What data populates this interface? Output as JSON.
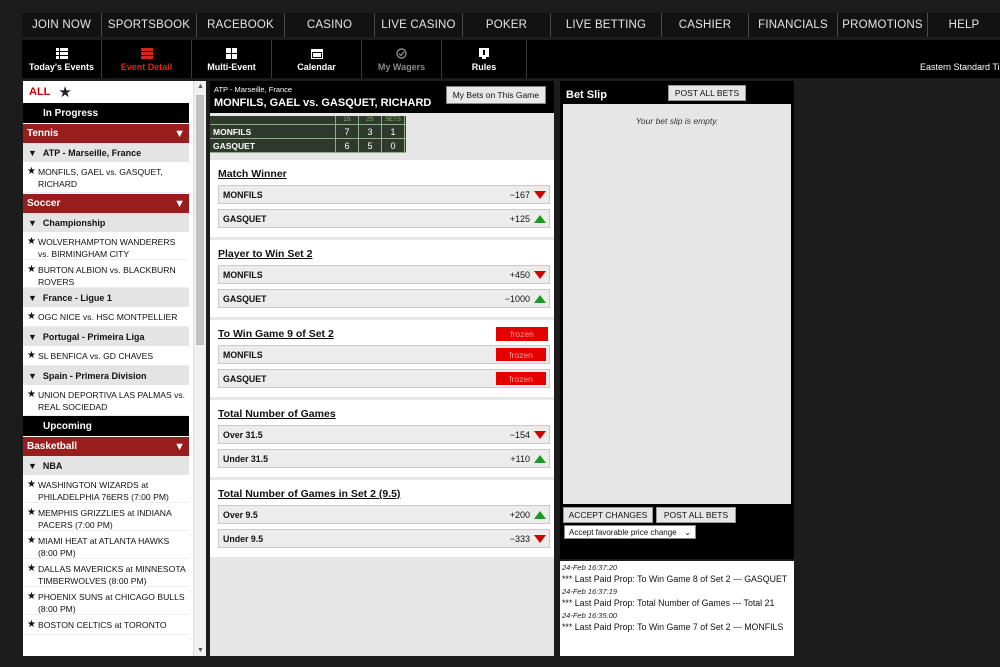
{
  "nav": [
    "JOIN NOW",
    "SPORTSBOOK",
    "RACEBOOK",
    "CASINO",
    "LIVE CASINO",
    "POKER",
    "LIVE BETTING",
    "CASHIER",
    "FINANCIALS",
    "PROMOTIONS",
    "HELP"
  ],
  "toolbar": {
    "items": [
      {
        "label": "Today's Events",
        "icon": "list-icon"
      },
      {
        "label": "Event Detail",
        "icon": "event-detail-icon"
      },
      {
        "label": "Multi-Event",
        "icon": "grid-icon"
      },
      {
        "label": "Calendar",
        "icon": "calendar-icon"
      },
      {
        "label": "My Wagers",
        "icon": "check-circle-icon"
      },
      {
        "label": "Rules",
        "icon": "book-icon"
      }
    ],
    "timezone": "Eastern Standard Time"
  },
  "sidebar": {
    "all_label": "ALL",
    "in_progress": "In Progress",
    "upcoming": "Upcoming",
    "tennis": {
      "sport": "Tennis",
      "league": "ATP - Marseille, France",
      "event": "MONFILS, GAEL vs. GASQUET, RICHARD"
    },
    "soccer": {
      "sport": "Soccer",
      "leagues": [
        {
          "name": "Championship",
          "events": [
            "WOLVERHAMPTON WANDERERS vs. BIRMINGHAM CITY",
            "BURTON ALBION vs. BLACKBURN ROVERS"
          ]
        },
        {
          "name": "France - Ligue 1",
          "events": [
            "OGC NICE vs. HSC MONTPELLIER"
          ]
        },
        {
          "name": "Portugal - Primeira Liga",
          "events": [
            "SL BENFICA vs. GD CHAVES"
          ]
        },
        {
          "name": "Spain - Primera Division",
          "events": [
            "UNION DEPORTIVA LAS PALMAS vs. REAL SOCIEDAD"
          ]
        }
      ]
    },
    "basketball": {
      "sport": "Basketball",
      "league": "NBA",
      "events": [
        "WASHINGTON WIZARDS at PHILADELPHIA 76ERS (7:00 PM)",
        "MEMPHIS GRIZZLIES at INDIANA PACERS (7:00 PM)",
        "MIAMI HEAT at ATLANTA HAWKS (8:00 PM)",
        "DALLAS MAVERICKS at MINNESOTA TIMBERWOLVES (8:00 PM)",
        "PHOENIX SUNS at CHICAGO BULLS (8:00 PM)",
        "BOSTON CELTICS at TORONTO"
      ]
    }
  },
  "event": {
    "league": "ATP - Marseille, France",
    "title": "MONFILS, GAEL vs. GASQUET, RICHARD",
    "my_bets_button": "My Bets on This Game",
    "scoreboard": {
      "headers": [
        "1S",
        "2S",
        "SETS"
      ],
      "rows": [
        {
          "name": "MONFILS",
          "scores": [
            "7",
            "3",
            "1"
          ]
        },
        {
          "name": "GASQUET",
          "scores": [
            "6",
            "5",
            "0"
          ]
        }
      ]
    }
  },
  "markets": [
    {
      "title": "Match Winner",
      "frozen": "",
      "selections": [
        {
          "name": "MONFILS",
          "odds": "−167",
          "trend": "down"
        },
        {
          "name": "GASQUET",
          "odds": "+125",
          "trend": "up"
        }
      ]
    },
    {
      "title": "Player to Win Set 2",
      "frozen": "",
      "selections": [
        {
          "name": "MONFILS",
          "odds": "+450",
          "trend": "down"
        },
        {
          "name": "GASQUET",
          "odds": "−1000",
          "trend": "up"
        }
      ]
    },
    {
      "title": "To Win Game 9 of Set 2",
      "frozen": "frozen",
      "selections": [
        {
          "name": "MONFILS",
          "odds": "frozen",
          "trend": "frozen"
        },
        {
          "name": "GASQUET",
          "odds": "frozen",
          "trend": "frozen"
        }
      ]
    },
    {
      "title": "Total Number of Games",
      "frozen": "",
      "selections": [
        {
          "name": "Over 31.5",
          "odds": "−154",
          "trend": "down"
        },
        {
          "name": "Under 31.5",
          "odds": "+110",
          "trend": "up"
        }
      ]
    },
    {
      "title": "Total Number of Games in Set 2 (9.5)",
      "frozen": "",
      "selections": [
        {
          "name": "Over 9.5",
          "odds": "+200",
          "trend": "up"
        },
        {
          "name": "Under 9.5",
          "odds": "−333",
          "trend": "down"
        }
      ]
    }
  ],
  "betslip": {
    "title": "Bet Slip",
    "post_all_top": "POST ALL BETS",
    "empty_message": "Your bet slip is empty.",
    "accept_changes": "ACCEPT CHANGES",
    "post_all_bottom": "POST ALL BETS",
    "price_option": "Accept favorable price change"
  },
  "last_paid": [
    {
      "time": "24-Feb 16:37:20",
      "text": "*** Last Paid Prop: To Win Game 8 of Set 2 --- GASQUET"
    },
    {
      "time": "24-Feb 16:37:19",
      "text": "*** Last Paid Prop: Total Number of Games --- Total 21"
    },
    {
      "time": "24-Feb 16:35:00",
      "text": "*** Last Paid Prop: To Win Game 7 of Set 2 --- MONFILS"
    }
  ],
  "colors": {
    "accent_red": "#9a1d1d",
    "down": "#d40000",
    "up": "#1c9a1c",
    "frozen": "#e50000"
  }
}
